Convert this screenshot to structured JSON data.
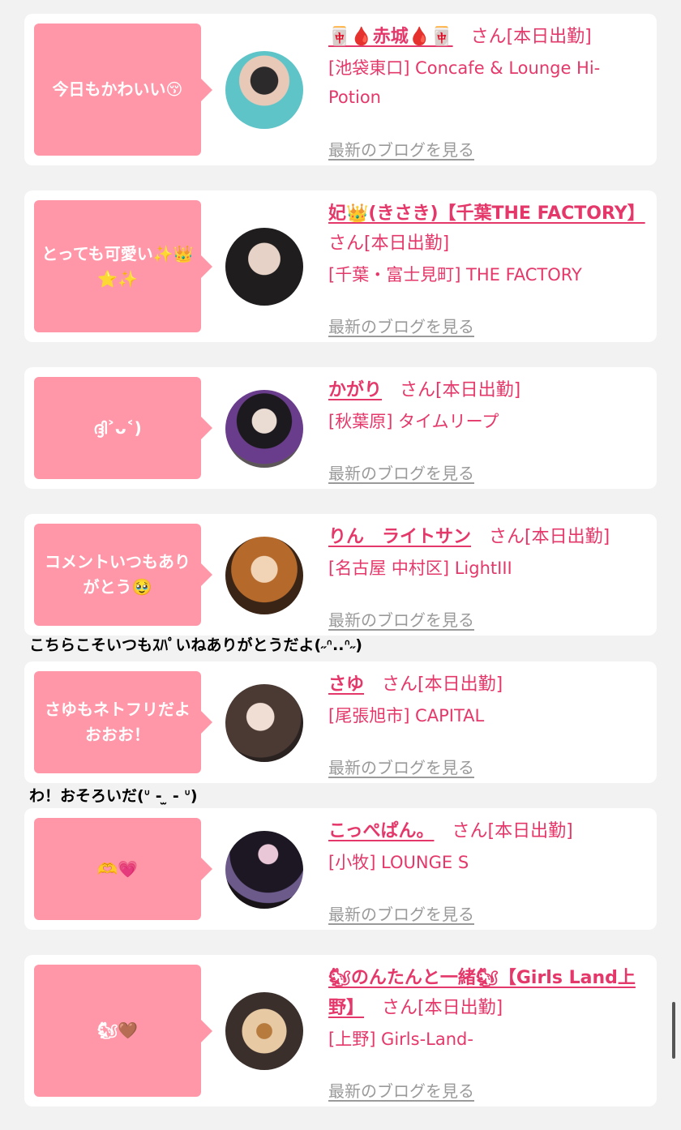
{
  "san_suffix": "さん",
  "attendance": "[本日出勤]",
  "blog_link": "最新のブログを見る",
  "cards": [
    {
      "comment": "今日もかわいい😚",
      "name": "🀄🩸赤城🩸🀄",
      "shop": "[池袋東口] Concafe & Lounge Hi-Potion"
    },
    {
      "comment": "とっても可愛い✨👑⭐✨",
      "name": "妃👑(きさき)【千葉THE FACTORY】",
      "shop": "[千葉・富士見町] THE FACTORY"
    },
    {
      "comment": "ദ്ദി˃ᴗ˂)",
      "name": "かがり",
      "shop": "[秋葉原] タイムリープ"
    },
    {
      "comment": "コメントいつもありがとう🥹",
      "name": "りん　ライトサン",
      "shop": "[名古屋 中村区] LightIII"
    },
    {
      "comment": "さゆもネトフリだよおおお！",
      "name": "さゆ",
      "shop": "[尾張旭市] CAPITAL"
    },
    {
      "comment": "🫶💗",
      "name": "こっぺぱん。",
      "shop": "[小牧] LOUNGE S"
    },
    {
      "comment": "🐿🤎",
      "name": "🐿のんたんと一緒🐿【Girls Land上野】",
      "shop": "[上野] Girls-Land-"
    }
  ],
  "replies": [
    "こちらこそいつもｽﾊﾟいねありがとうだよ(˶ᐢ..ᐢ˶)",
    "わ！おそろいだ(ᐡ - ̫ - ᐡ)"
  ]
}
